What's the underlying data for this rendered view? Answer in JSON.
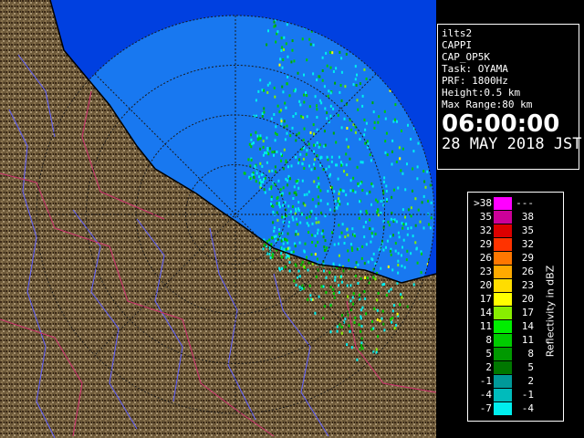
{
  "radar_view": {
    "station": "ilts2",
    "product": "CAPPI",
    "scan": "CAP_OP5K",
    "task": "Task: OYAMA",
    "prf": "PRF: 1800Hz",
    "height": "Height:0.5 km",
    "max_range": "Max Range:80 km",
    "time": "06:00:00",
    "date": "28 MAY 2018 JST"
  },
  "legend": {
    "unit_label": "Reflectivity in dBZ",
    "rows": [
      {
        "lo": ">38",
        "hi": "---",
        "color": "#ff00ff"
      },
      {
        "lo": "35",
        "hi": "38",
        "color": "#cc0099"
      },
      {
        "lo": "32",
        "hi": "35",
        "color": "#dd0000"
      },
      {
        "lo": "29",
        "hi": "32",
        "color": "#ff3300"
      },
      {
        "lo": "26",
        "hi": "29",
        "color": "#ff7700"
      },
      {
        "lo": "23",
        "hi": "26",
        "color": "#ffaa00"
      },
      {
        "lo": "20",
        "hi": "23",
        "color": "#ffdd00"
      },
      {
        "lo": "17",
        "hi": "20",
        "color": "#ffff00"
      },
      {
        "lo": "14",
        "hi": "17",
        "color": "#88ee00"
      },
      {
        "lo": "11",
        "hi": "14",
        "color": "#00ee00"
      },
      {
        "lo": "8",
        "hi": "11",
        "color": "#00cc00"
      },
      {
        "lo": "5",
        "hi": "8",
        "color": "#009900"
      },
      {
        "lo": "2",
        "hi": "5",
        "color": "#007700"
      },
      {
        "lo": "-1",
        "hi": "2",
        "color": "#009999"
      },
      {
        "lo": "-4",
        "hi": "-1",
        "color": "#00bbbb"
      },
      {
        "lo": "-7",
        "hi": "-4",
        "color": "#00eeee"
      }
    ]
  },
  "colors": {
    "sea": "#0040e0",
    "land": "#6e5a3a",
    "land_dark": "#3c2a18",
    "land_light": "#a89472",
    "river": "#6060ff",
    "boundary": "#d03070",
    "range_ring": "#1a1a1a",
    "echo_low": "#00eeee",
    "echo_mid": "#00cc00",
    "echo_high": "#ffff00"
  },
  "map": {
    "rings_km": [
      20,
      40,
      60,
      80
    ],
    "max_range_km": 80
  }
}
